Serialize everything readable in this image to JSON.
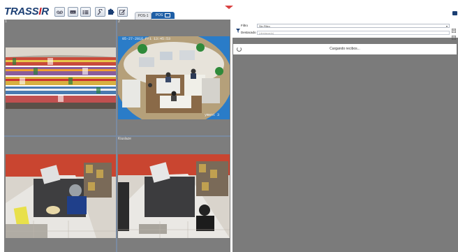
{
  "app": {
    "logo_text": "TRASSIR"
  },
  "toolbar": {
    "icons": [
      "recorder-icon",
      "monitor-icon",
      "list-icon",
      "wrench-icon",
      "puzzle-icon",
      "edit-icon"
    ]
  },
  "tabs": [
    {
      "label": "POS-1",
      "active": false
    },
    {
      "label": "POS",
      "active": true
    }
  ],
  "video": {
    "cells": [
      {
        "number": "1",
        "overlay": ""
      },
      {
        "number": "2",
        "overlay": "05-27-2016 Fri 13:45:53"
      },
      {
        "number": "",
        "overlay": ""
      },
      {
        "number": "Kiuslaze",
        "overlay": ""
      }
    ],
    "cell2_caption": "yment 3"
  },
  "panel": {
    "filter_label": "Filtro",
    "filter_value": "Sin Filtro",
    "highlight_label": "Destacado",
    "highlight_placeholder": "(destacado)",
    "loading_text": "Cargando recibos..."
  },
  "colors": {
    "accent": "#1f5fa6",
    "logo_red": "#c8202a",
    "logo_dark": "#1b3e73"
  }
}
